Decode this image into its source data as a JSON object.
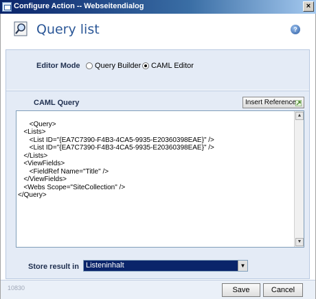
{
  "window": {
    "title": "Configure Action -- Webseitendialog",
    "close_label": "×"
  },
  "header": {
    "title": "Query list",
    "help_label": "?"
  },
  "editor_mode": {
    "label": "Editor Mode",
    "options": [
      {
        "label": "Query Builder",
        "selected": false
      },
      {
        "label": "CAML Editor",
        "selected": true
      }
    ]
  },
  "caml": {
    "label": "CAML Query",
    "insert_reference_label": "Insert Reference",
    "query_text": "<Query>\n   <Lists>\n      <List ID=\"{EA7C7390-F4B3-4CA5-9935-E20360398EAE}\" />\n      <List ID=\"{EA7C7390-F4B3-4CA5-9935-E20360398EAE}\" />\n   </Lists>\n   <ViewFields>\n      <FieldRef Name=\"Title\" />\n   </ViewFields>\n   <Webs Scope=\"SiteCollection\" />\n</Query>"
  },
  "store_result": {
    "label": "Store result in",
    "selected_value": "Listeninhalt"
  },
  "footer": {
    "code": "10830",
    "save_label": "Save",
    "cancel_label": "Cancel"
  },
  "colors": {
    "title_bar": "#0a246a",
    "accent": "#2b5797",
    "panel_bg": "#e4ebf6"
  }
}
